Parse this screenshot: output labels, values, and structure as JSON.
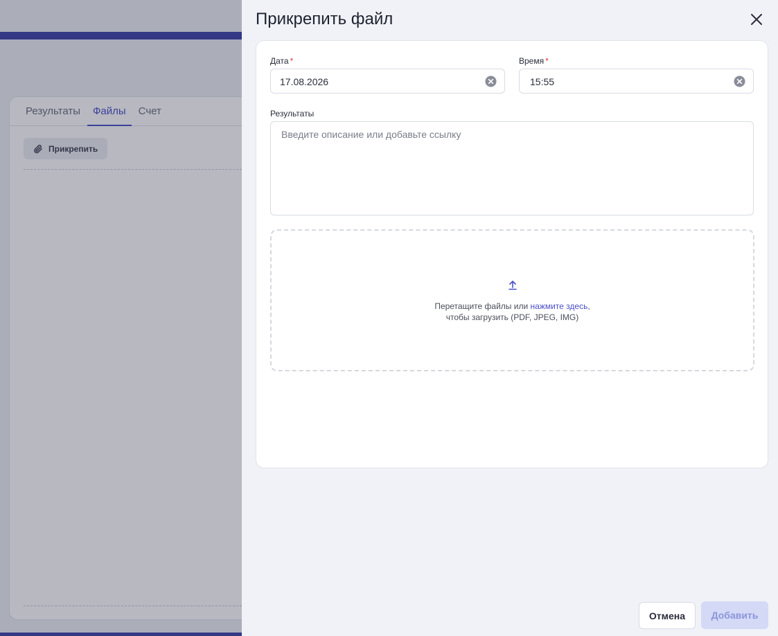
{
  "background": {
    "tabs": [
      {
        "label": "Результаты"
      },
      {
        "label": "Файлы",
        "active": true
      },
      {
        "label": "Счет"
      }
    ],
    "attach_button": "Прикрепить"
  },
  "drawer": {
    "title": "Прикрепить файл",
    "date": {
      "label": "Дата",
      "required_mark": "*",
      "value": "17.08.2026"
    },
    "time": {
      "label": "Время",
      "required_mark": "*",
      "value": "15:55"
    },
    "results": {
      "label": "Результаты",
      "placeholder": "Введите описание или добавьте ссылку"
    },
    "dropzone": {
      "text_before_link": "Перетащите файлы или ",
      "link": "нажмите здесь",
      "text_after_link": ",",
      "line2": "чтобы загрузить (PDF, JPEG, IMG)"
    },
    "cancel_label": "Отмена",
    "add_label": "Добавить"
  },
  "colors": {
    "accent": "#4a4fc8",
    "required": "#d93a3a",
    "add_disabled_bg": "#d4d9f6",
    "add_disabled_text": "#8c95d9"
  },
  "icons": {
    "close": "close-icon",
    "clear": "clear-icon",
    "upload": "upload-icon",
    "attach": "paperclip-icon"
  }
}
